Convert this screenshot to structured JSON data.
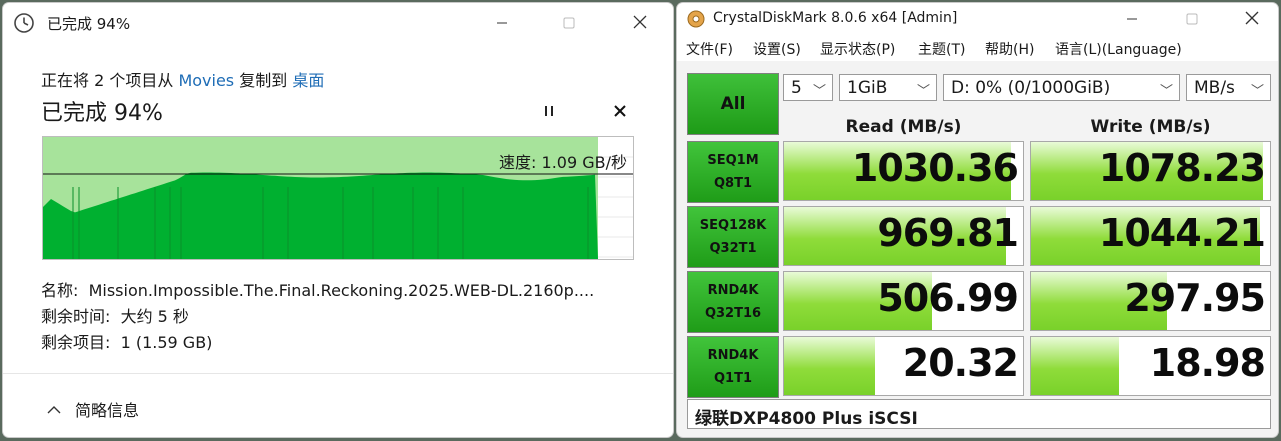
{
  "copy_dialog": {
    "title": "已完成 94%",
    "source_line": {
      "prefix": "正在将 2 个项目从 ",
      "source": "Movies",
      "middle": " 复制到 ",
      "destination": "桌面"
    },
    "progress_heading": "已完成 94%",
    "progress_percent": 94,
    "speed_label": "速度: 1.09 GB/秒",
    "graph_color": "#00b030",
    "graph_light_color": "#a7e39b",
    "info": {
      "name_label": "名称:",
      "name_value": "Mission.Impossible.The.Final.Reckoning.2025.WEB-DL.2160p....",
      "time_label": "剩余时间:",
      "time_value": "大约 5 秒",
      "items_label": "剩余项目:",
      "items_value": "1 (1.59 GB)"
    },
    "details_toggle": "简略信息"
  },
  "cdm": {
    "title": "CrystalDiskMark 8.0.6 x64 [Admin]",
    "menu": [
      "文件(F)",
      "设置(S)",
      "显示状态(P)",
      "主题(T)",
      "帮助(H)",
      "语言(L)(Language)"
    ],
    "all_button": "All",
    "count": "5",
    "size": "1GiB",
    "drive": "D: 0% (0/1000GiB)",
    "unit": "MB/s",
    "read_header": "Read (MB/s)",
    "write_header": "Write (MB/s)",
    "tests": [
      {
        "line1": "SEQ1M",
        "line2": "Q8T1",
        "read": "1030.36",
        "write": "1078.23",
        "read_fill": 0.95,
        "write_fill": 0.97
      },
      {
        "line1": "SEQ128K",
        "line2": "Q32T1",
        "read": "969.81",
        "write": "1044.21",
        "read_fill": 0.93,
        "write_fill": 0.96
      },
      {
        "line1": "RND4K",
        "line2": "Q32T16",
        "read": "506.99",
        "write": "297.95",
        "read_fill": 0.62,
        "write_fill": 0.57
      },
      {
        "line1": "RND4K",
        "line2": "Q1T1",
        "read": "20.32",
        "write": "18.98",
        "read_fill": 0.38,
        "write_fill": 0.37
      }
    ],
    "comment": "绿联DXP4800 Plus iSCSI",
    "accent": "#22a31b"
  }
}
